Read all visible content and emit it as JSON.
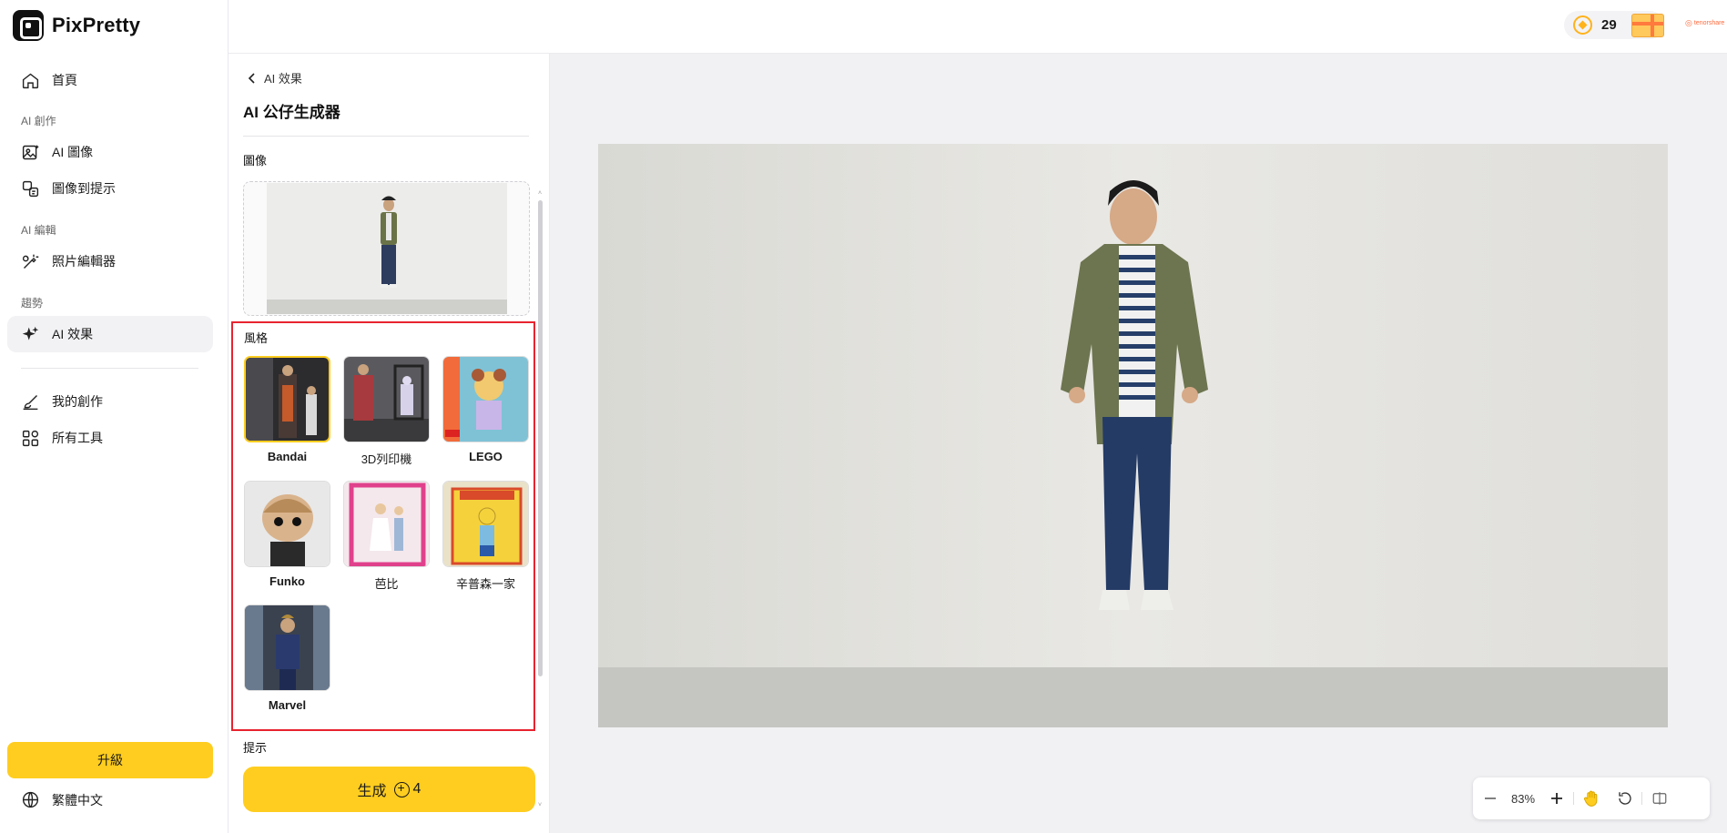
{
  "app": {
    "name": "PixPretty"
  },
  "sidebar": {
    "home": "首頁",
    "section_create": "AI 創作",
    "ai_image": "AI 圖像",
    "image_to_prompt": "圖像到提示",
    "section_edit": "AI 編輯",
    "photo_editor": "照片編輯器",
    "section_trend": "趨勢",
    "ai_effects": "AI 效果",
    "my_creations": "我的創作",
    "all_tools": "所有工具",
    "upgrade": "升級",
    "language": "繁體中文"
  },
  "topbar": {
    "credits": "29",
    "brand_small": "tenorshare"
  },
  "panel": {
    "back_label": "AI 效果",
    "title": "AI 公仔生成器",
    "image_label": "圖像",
    "style_label": "風格",
    "prompt_label": "提示",
    "styles": [
      {
        "name": "Bandai",
        "selected": true
      },
      {
        "name": "3D列印機",
        "selected": false
      },
      {
        "name": "LEGO",
        "selected": false
      },
      {
        "name": "Funko",
        "selected": false
      },
      {
        "name": "芭比",
        "selected": false
      },
      {
        "name": "辛普森一家",
        "selected": false
      },
      {
        "name": "Marvel",
        "selected": false
      }
    ],
    "generate_label": "生成",
    "generate_cost": "4"
  },
  "canvas": {
    "zoom": "83%"
  },
  "colors": {
    "accent": "#ffcd1f",
    "highlight_border": "#e8232f"
  }
}
